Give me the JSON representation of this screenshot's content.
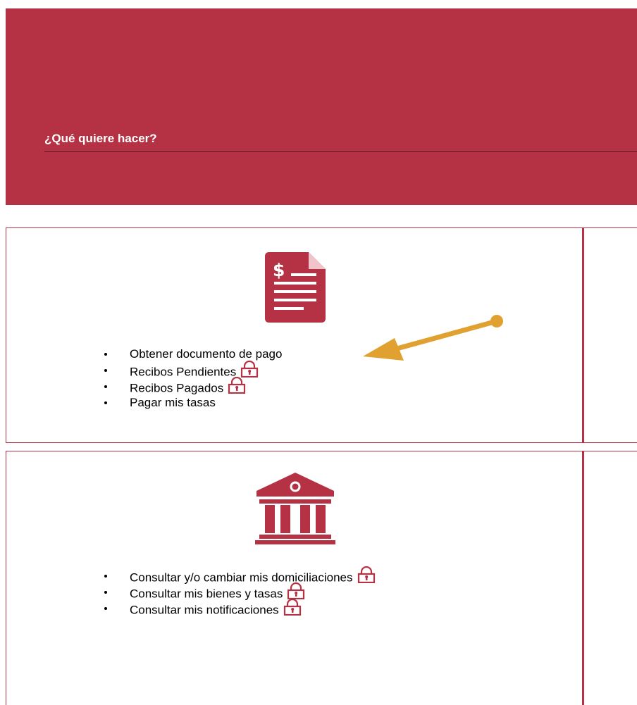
{
  "header": {
    "question_label": "¿Qué quiere hacer?"
  },
  "colors": {
    "brand": "#b53245",
    "arrow": "#e0a130",
    "divider": "#5b1a24"
  },
  "sections": [
    {
      "icon": "invoice-document-icon",
      "items": [
        {
          "label": "Obtener documento de pago",
          "locked": false
        },
        {
          "label": "Recibos Pendientes",
          "locked": true
        },
        {
          "label": "Recibos Pagados",
          "locked": true
        },
        {
          "label": "Pagar mis tasas",
          "locked": false
        }
      ]
    },
    {
      "icon": "bank-building-icon",
      "items": [
        {
          "label": "Consultar y/o cambiar mis domiciliaciones",
          "locked": true
        },
        {
          "label": "Consultar mis bienes y tasas",
          "locked": true
        },
        {
          "label": "Consultar mis notificaciones",
          "locked": true
        }
      ]
    }
  ]
}
